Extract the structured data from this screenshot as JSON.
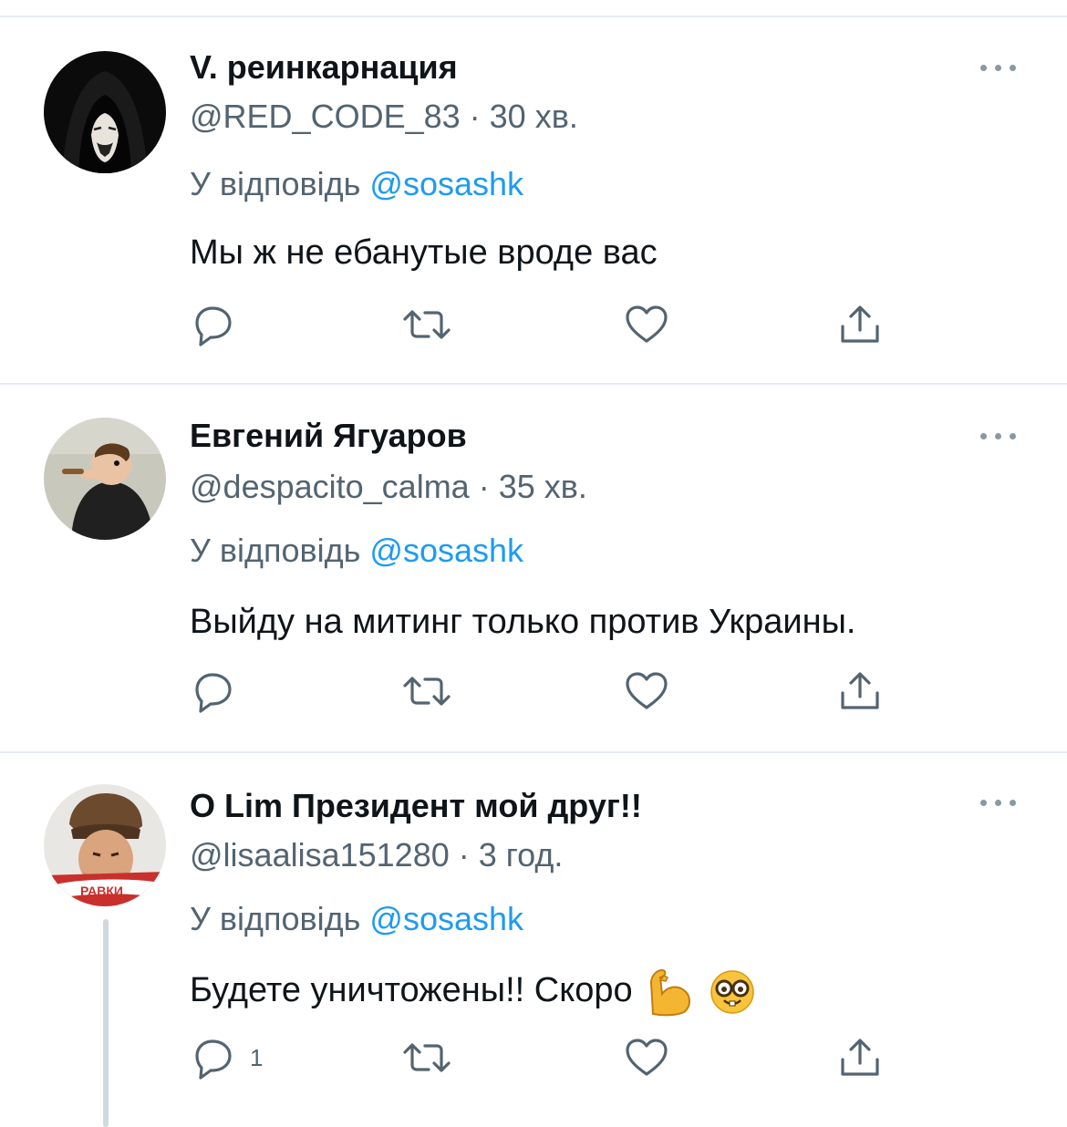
{
  "tweets": [
    {
      "name": "V. реинкарнация",
      "handle": "@RED_CODE_83",
      "time": "· 30 хв.",
      "reply_prefix": "У відповідь",
      "reply_mention": "@sosashk",
      "text": "Мы ж не ебанутые вроде вас",
      "reply_count": ""
    },
    {
      "name": "Евгений Ягуаров",
      "handle": "@despacito_calma",
      "time": "· 35 хв.",
      "reply_prefix": "У відповідь",
      "reply_mention": "@sosashk",
      "text": "Выйду на митинг только против Украины.",
      "reply_count": ""
    },
    {
      "name": "O Lim Президент мой друг!!",
      "handle": "@lisaalisa151280",
      "time": "· 3 год.",
      "reply_prefix": "У відповідь",
      "reply_mention": "@sosashk",
      "text": "Будете уничтожены!! Скоро",
      "reply_count": "1",
      "avatar_badge": "РАВКИ"
    }
  ],
  "icons": {
    "reply": "reply-icon",
    "retweet": "retweet-icon",
    "like": "heart-icon",
    "share": "share-icon",
    "more": "more-options-icon"
  },
  "colors": {
    "accent": "#1d9bf0",
    "secondary_text": "#536471",
    "divider": "#e6ecf0"
  }
}
